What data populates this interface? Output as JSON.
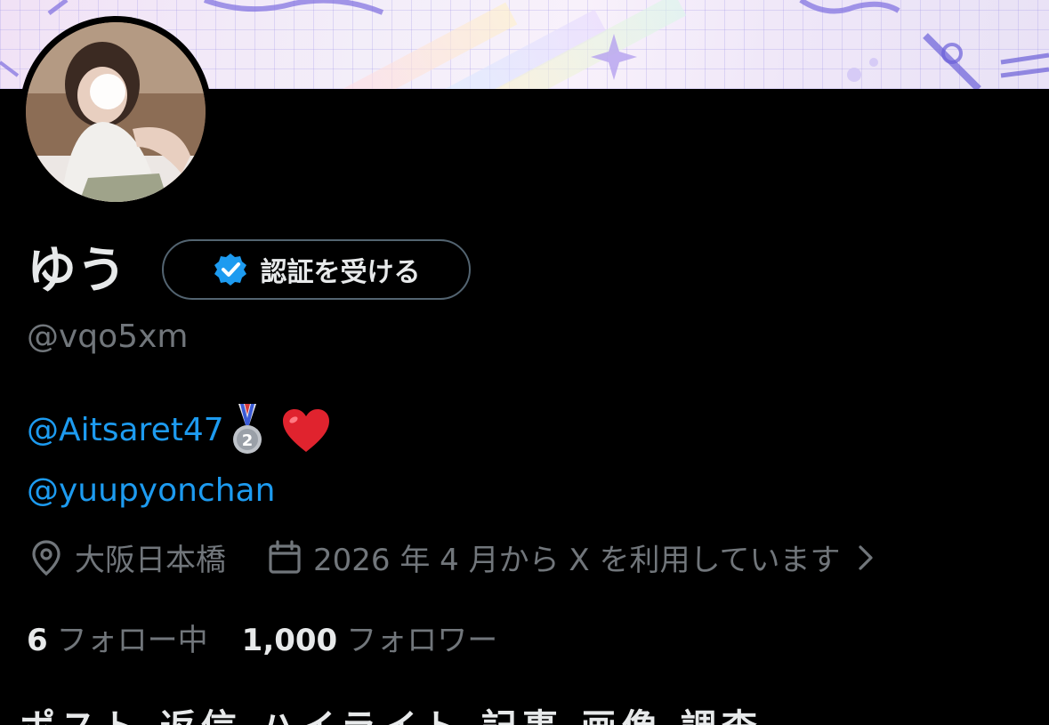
{
  "profile": {
    "display_name": "ゆう",
    "handle": "@vqo5xm",
    "verify_button_label": "認証を受ける",
    "bio": {
      "mention_1": "@Aitsaret47",
      "mention_2": "@yuupyonchan",
      "emoji_1": "second-place-medal-icon",
      "emoji_2": "red-heart-icon"
    },
    "location": "大阪日本橋",
    "joined": "2026 年 4 月から X を利用しています",
    "following_count": "6",
    "following_label": "フォロー中",
    "followers_count": "1,000",
    "followers_label": "フォロワー"
  },
  "tabs": {
    "partial_text": "ポスト 返信 ハイライト 記事 画像 調査"
  },
  "colors": {
    "background": "#000000",
    "text_primary": "#e7e9ea",
    "text_secondary": "#71767b",
    "accent": "#1d9bf0",
    "border": "#536471"
  }
}
